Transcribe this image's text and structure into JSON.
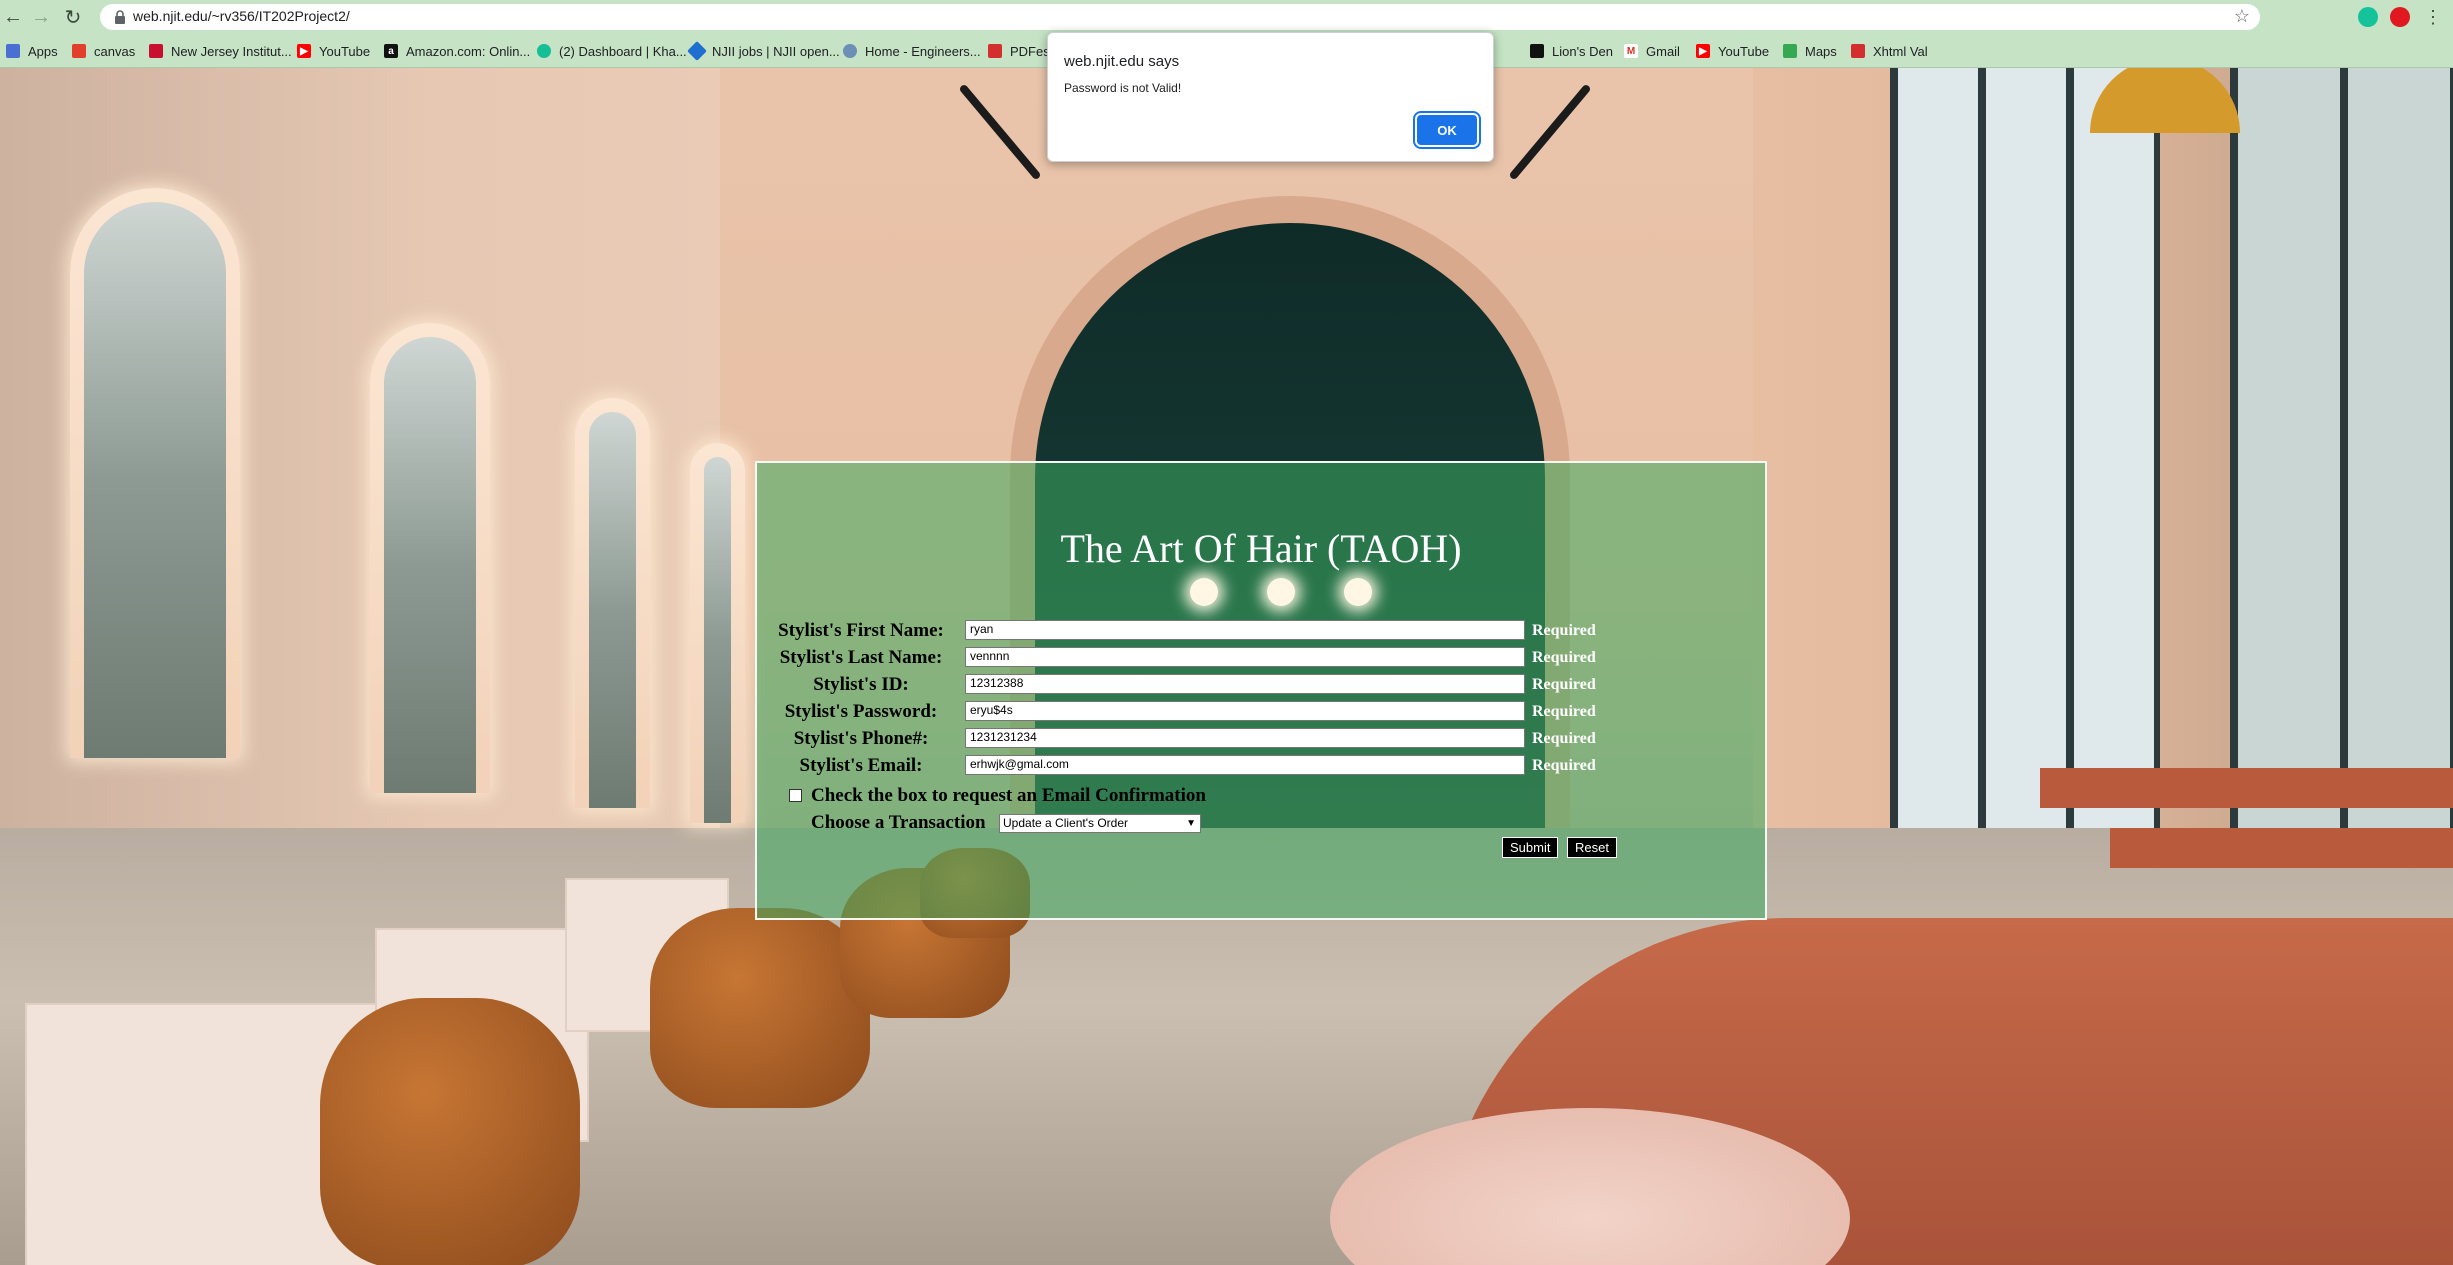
{
  "browser": {
    "url": "web.njit.edu/~rv356/IT202Project2/",
    "bookmarks": [
      {
        "label": "Apps",
        "icon": "apps-grid-icon",
        "color": "#4a6fd3"
      },
      {
        "label": "canvas",
        "icon": "canvas-icon",
        "color": "#e13f2b"
      },
      {
        "label": "New Jersey Institut...",
        "icon": "njit-icon",
        "color": "#c8102e"
      },
      {
        "label": "YouTube",
        "icon": "youtube-icon",
        "color": "#ff0000"
      },
      {
        "label": "Amazon.com: Onlin...",
        "icon": "amazon-icon",
        "color": "#111111"
      },
      {
        "label": "(2) Dashboard | Kha...",
        "icon": "khan-academy-icon",
        "color": "#14bf96"
      },
      {
        "label": "NJII jobs | NJII open...",
        "icon": "njii-icon",
        "color": "#1f6fd0"
      },
      {
        "label": "Home - Engineers...",
        "icon": "globe-icon",
        "color": "#6b8fb5"
      },
      {
        "label": "PDFesc",
        "icon": "pdf-icon",
        "color": "#d32f2f"
      },
      {
        "label": "Lion's Den",
        "icon": "lion-den-icon",
        "color": "#111111"
      },
      {
        "label": "Gmail",
        "icon": "gmail-icon",
        "color": "#d93025"
      },
      {
        "label": "YouTube",
        "icon": "youtube-icon",
        "color": "#ff0000"
      },
      {
        "label": "Maps",
        "icon": "maps-icon",
        "color": "#34a853"
      },
      {
        "label": "Xhtml Val",
        "icon": "validator-icon",
        "color": "#d32f2f"
      }
    ]
  },
  "alert": {
    "host": "web.njit.edu says",
    "message": "Password is not Valid!",
    "ok_label": "OK"
  },
  "form": {
    "title": "The Art Of Hair (TAOH)",
    "required_label": "Required",
    "fields": [
      {
        "label": "Stylist's First Name:",
        "value": "ryan"
      },
      {
        "label": "Stylist's Last Name:",
        "value": "vennnn"
      },
      {
        "label": "Stylist's ID:",
        "value": "12312388"
      },
      {
        "label": "Stylist's Password:",
        "value": "eryu$4s"
      },
      {
        "label": "Stylist's Phone#:",
        "value": "1231231234"
      },
      {
        "label": "Stylist's Email:",
        "value": "erhwjk@gmal.com"
      }
    ],
    "email_confirm_label": "Check the box to request an Email Confirmation",
    "transaction_label": "Choose a Transaction",
    "transaction_selected": "Update a Client's Order",
    "submit_label": "Submit",
    "reset_label": "Reset"
  },
  "colors": {
    "chrome": "#c6e4c5",
    "panel": "rgba(60,170,95,0.55)",
    "ok_button": "#1a73e8"
  }
}
